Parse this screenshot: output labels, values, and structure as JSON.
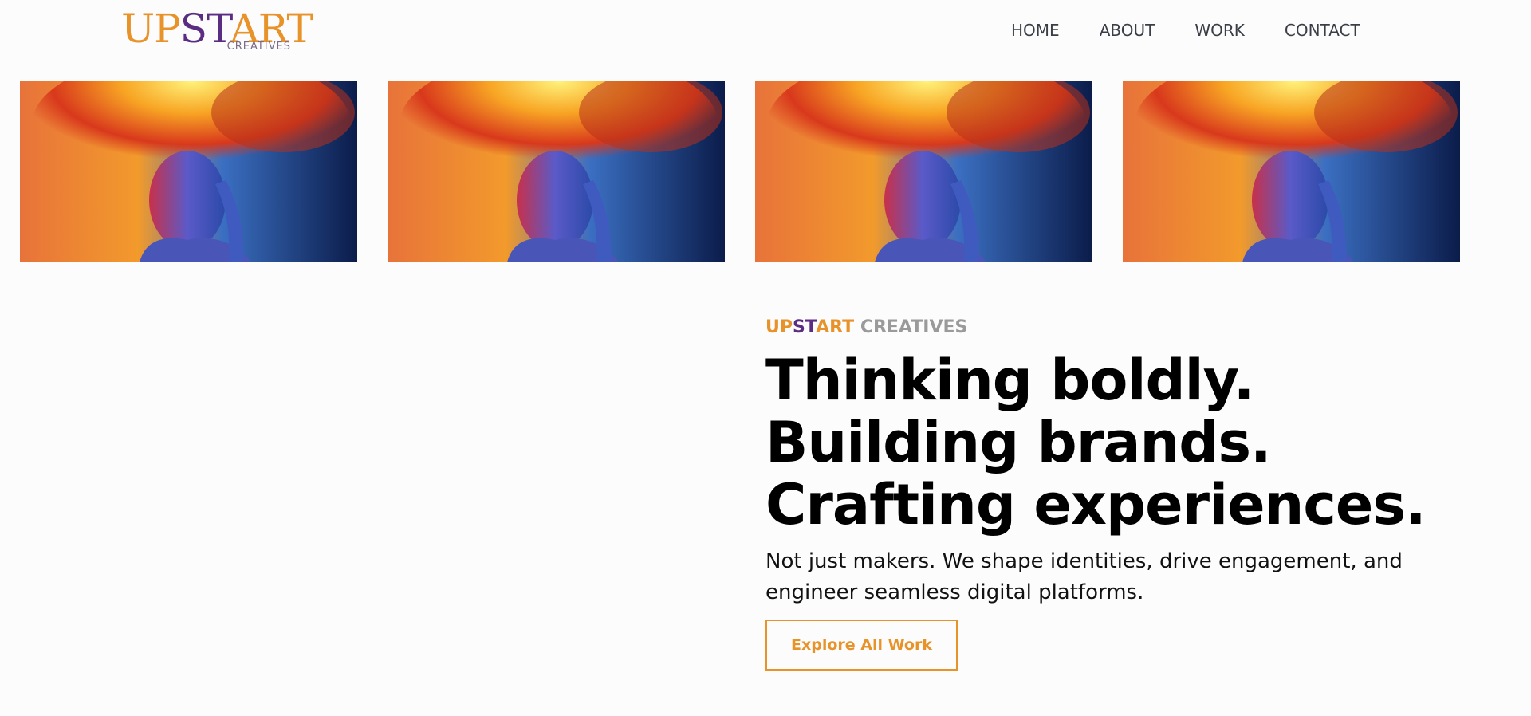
{
  "brand": {
    "logo": {
      "up": "UP",
      "st": "ST",
      "art": "ART",
      "sub": "CREATIVES"
    },
    "colors": {
      "orange": "#e8922a",
      "purple": "#5a2d82",
      "gray": "#9a9a9a"
    }
  },
  "nav": {
    "items": [
      {
        "label": "HOME"
      },
      {
        "label": "ABOUT"
      },
      {
        "label": "WORK"
      },
      {
        "label": "CONTACT"
      }
    ]
  },
  "gallery": {
    "images": [
      {
        "icon": "fire-hair-portrait-image"
      },
      {
        "icon": "fire-hair-portrait-image"
      },
      {
        "icon": "fire-hair-portrait-image"
      },
      {
        "icon": "fire-hair-portrait-image"
      }
    ]
  },
  "hero": {
    "eyebrow": {
      "up": "UP",
      "st": "ST",
      "art": "ART",
      "creatives": " CREATIVES"
    },
    "headline": [
      "Thinking boldly.",
      "Building brands.",
      "Crafting experiences."
    ],
    "lead": "Not just makers. We shape identities, drive engagement, and engineer seamless digital platforms.",
    "cta_label": "Explore All Work"
  }
}
